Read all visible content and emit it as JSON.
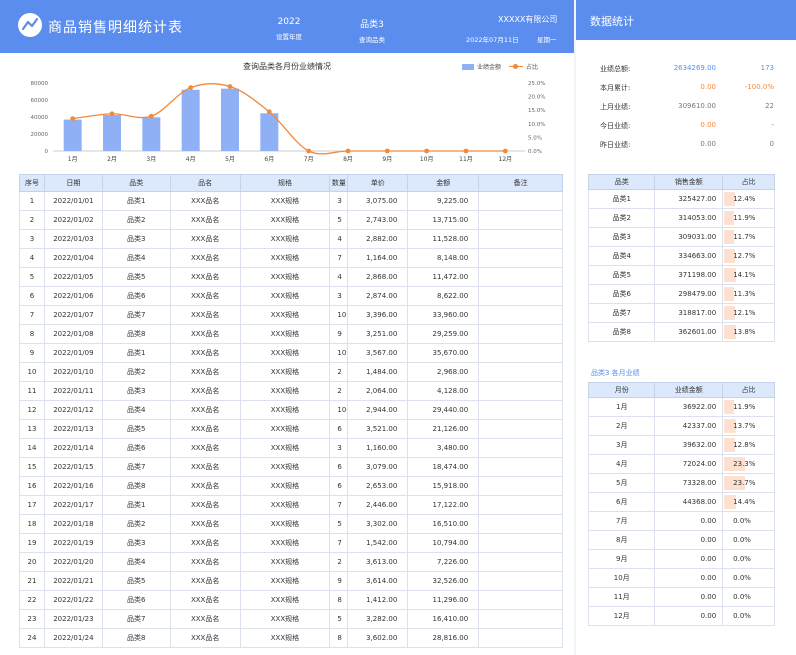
{
  "header": {
    "title": "商品销售明细统计表",
    "year_value": "2022",
    "year_label": "设置年度",
    "category_value": "品类3",
    "category_label": "查询品类",
    "company": "XXXXX有限公司",
    "date": "2022年07月11日",
    "weekday": "星期一",
    "accent_color": "#5b8def"
  },
  "right_header": {
    "title": "数据统计"
  },
  "chart_data": {
    "type": "bar",
    "title": "查询品类各月份业绩情况",
    "categories": [
      "1月",
      "2月",
      "3月",
      "4月",
      "5月",
      "6月",
      "7月",
      "8月",
      "9月",
      "10月",
      "11月",
      "12月"
    ],
    "series": [
      {
        "name": "业绩金额",
        "type": "bar",
        "axis": "left",
        "color": "#8fb0f4",
        "values": [
          36922,
          42337,
          39632,
          72024,
          73328,
          44368,
          0,
          0,
          0,
          0,
          0,
          0
        ]
      },
      {
        "name": "占比",
        "type": "line",
        "axis": "right",
        "color": "#f08a3c",
        "values": [
          11.9,
          13.7,
          12.8,
          23.3,
          23.7,
          14.4,
          0,
          0,
          0,
          0,
          0,
          0
        ]
      }
    ],
    "ylim_left": [
      0,
      80000
    ],
    "yticks_left": [
      "0",
      "20000",
      "40000",
      "60000",
      "80000"
    ],
    "ylim_right": [
      0,
      25
    ],
    "yticks_right": [
      "0.0%",
      "5.0%",
      "10.0%",
      "15.0%",
      "20.0%",
      "25.0%"
    ],
    "legend_position": "top-right",
    "grid": false
  },
  "table": {
    "headers": [
      "序号",
      "日期",
      "品类",
      "品名",
      "规格",
      "数量",
      "单价",
      "金额",
      "备注"
    ],
    "rows": [
      [
        "1",
        "2022/01/01",
        "品类1",
        "XXX品名",
        "XXX规格",
        "3",
        "3,075.00",
        "9,225.00",
        ""
      ],
      [
        "2",
        "2022/01/02",
        "品类2",
        "XXX品名",
        "XXX规格",
        "5",
        "2,743.00",
        "13,715.00",
        ""
      ],
      [
        "3",
        "2022/01/03",
        "品类3",
        "XXX品名",
        "XXX规格",
        "4",
        "2,882.00",
        "11,528.00",
        ""
      ],
      [
        "4",
        "2022/01/04",
        "品类4",
        "XXX品名",
        "XXX规格",
        "7",
        "1,164.00",
        "8,148.00",
        ""
      ],
      [
        "5",
        "2022/01/05",
        "品类5",
        "XXX品名",
        "XXX规格",
        "4",
        "2,868.00",
        "11,472.00",
        ""
      ],
      [
        "6",
        "2022/01/06",
        "品类6",
        "XXX品名",
        "XXX规格",
        "3",
        "2,874.00",
        "8,622.00",
        ""
      ],
      [
        "7",
        "2022/01/07",
        "品类7",
        "XXX品名",
        "XXX规格",
        "10",
        "3,396.00",
        "33,960.00",
        ""
      ],
      [
        "8",
        "2022/01/08",
        "品类8",
        "XXX品名",
        "XXX规格",
        "9",
        "3,251.00",
        "29,259.00",
        ""
      ],
      [
        "9",
        "2022/01/09",
        "品类1",
        "XXX品名",
        "XXX规格",
        "10",
        "3,567.00",
        "35,670.00",
        ""
      ],
      [
        "10",
        "2022/01/10",
        "品类2",
        "XXX品名",
        "XXX规格",
        "2",
        "1,484.00",
        "2,968.00",
        ""
      ],
      [
        "11",
        "2022/01/11",
        "品类3",
        "XXX品名",
        "XXX规格",
        "2",
        "2,064.00",
        "4,128.00",
        ""
      ],
      [
        "12",
        "2022/01/12",
        "品类4",
        "XXX品名",
        "XXX规格",
        "10",
        "2,944.00",
        "29,440.00",
        ""
      ],
      [
        "13",
        "2022/01/13",
        "品类5",
        "XXX品名",
        "XXX规格",
        "6",
        "3,521.00",
        "21,126.00",
        ""
      ],
      [
        "14",
        "2022/01/14",
        "品类6",
        "XXX品名",
        "XXX规格",
        "3",
        "1,160.00",
        "3,480.00",
        ""
      ],
      [
        "15",
        "2022/01/15",
        "品类7",
        "XXX品名",
        "XXX规格",
        "6",
        "3,079.00",
        "18,474.00",
        ""
      ],
      [
        "16",
        "2022/01/16",
        "品类8",
        "XXX品名",
        "XXX规格",
        "6",
        "2,653.00",
        "15,918.00",
        ""
      ],
      [
        "17",
        "2022/01/17",
        "品类1",
        "XXX品名",
        "XXX规格",
        "7",
        "2,446.00",
        "17,122.00",
        ""
      ],
      [
        "18",
        "2022/01/18",
        "品类2",
        "XXX品名",
        "XXX规格",
        "5",
        "3,302.00",
        "16,510.00",
        ""
      ],
      [
        "19",
        "2022/01/19",
        "品类3",
        "XXX品名",
        "XXX规格",
        "7",
        "1,542.00",
        "10,794.00",
        ""
      ],
      [
        "20",
        "2022/01/20",
        "品类4",
        "XXX品名",
        "XXX规格",
        "2",
        "3,613.00",
        "7,226.00",
        ""
      ],
      [
        "21",
        "2022/01/21",
        "品类5",
        "XXX品名",
        "XXX规格",
        "9",
        "3,614.00",
        "32,526.00",
        ""
      ],
      [
        "22",
        "2022/01/22",
        "品类6",
        "XXX品名",
        "XXX规格",
        "8",
        "1,412.00",
        "11,296.00",
        ""
      ],
      [
        "23",
        "2022/01/23",
        "品类7",
        "XXX品名",
        "XXX规格",
        "5",
        "3,282.00",
        "16,410.00",
        ""
      ],
      [
        "24",
        "2022/01/24",
        "品类8",
        "XXX品名",
        "XXX规格",
        "8",
        "3,602.00",
        "28,816.00",
        ""
      ]
    ]
  },
  "stats": [
    {
      "label": "业绩总额:",
      "value": "2634269.00",
      "extra": "173",
      "value_color": "blue",
      "extra_color": "blue"
    },
    {
      "label": "本月累计:",
      "value": "0.00",
      "extra": "-100.0%",
      "value_color": "orange",
      "extra_color": "orange"
    },
    {
      "label": "上月业绩:",
      "value": "309610.00",
      "extra": "22",
      "value_color": "",
      "extra_color": ""
    },
    {
      "label": "今日业绩:",
      "value": "0.00",
      "extra": "-",
      "value_color": "orange",
      "extra_color": ""
    },
    {
      "label": "昨日业绩:",
      "value": "0.00",
      "extra": "0",
      "value_color": "",
      "extra_color": ""
    }
  ],
  "category_table": {
    "headers": [
      "品类",
      "销售金额",
      "占比"
    ],
    "rows": [
      {
        "name": "品类1",
        "amount": "325427.00",
        "pct": "12.4%",
        "share": 0.124
      },
      {
        "name": "品类2",
        "amount": "314053.00",
        "pct": "11.9%",
        "share": 0.119
      },
      {
        "name": "品类3",
        "amount": "309031.00",
        "pct": "11.7%",
        "share": 0.117
      },
      {
        "name": "品类4",
        "amount": "334663.00",
        "pct": "12.7%",
        "share": 0.127
      },
      {
        "name": "品类5",
        "amount": "371198.00",
        "pct": "14.1%",
        "share": 0.141
      },
      {
        "name": "品类6",
        "amount": "298479.00",
        "pct": "11.3%",
        "share": 0.113
      },
      {
        "name": "品类7",
        "amount": "318817.00",
        "pct": "12.1%",
        "share": 0.121
      },
      {
        "name": "品类8",
        "amount": "362601.00",
        "pct": "13.8%",
        "share": 0.138
      }
    ]
  },
  "month_caption": "品类3  各月业绩",
  "month_table": {
    "headers": [
      "月份",
      "业绩金额",
      "占比"
    ],
    "rows": [
      {
        "name": "1月",
        "amount": "36922.00",
        "pct": "11.9%",
        "share": 0.119
      },
      {
        "name": "2月",
        "amount": "42337.00",
        "pct": "13.7%",
        "share": 0.137
      },
      {
        "name": "3月",
        "amount": "39632.00",
        "pct": "12.8%",
        "share": 0.128
      },
      {
        "name": "4月",
        "amount": "72024.00",
        "pct": "23.3%",
        "share": 0.233
      },
      {
        "name": "5月",
        "amount": "73328.00",
        "pct": "23.7%",
        "share": 0.237
      },
      {
        "name": "6月",
        "amount": "44368.00",
        "pct": "14.4%",
        "share": 0.144
      },
      {
        "name": "7月",
        "amount": "0.00",
        "pct": "0.0%",
        "share": 0
      },
      {
        "name": "8月",
        "amount": "0.00",
        "pct": "0.0%",
        "share": 0
      },
      {
        "name": "9月",
        "amount": "0.00",
        "pct": "0.0%",
        "share": 0
      },
      {
        "name": "10月",
        "amount": "0.00",
        "pct": "0.0%",
        "share": 0
      },
      {
        "name": "11月",
        "amount": "0.00",
        "pct": "0.0%",
        "share": 0
      },
      {
        "name": "12月",
        "amount": "0.00",
        "pct": "0.0%",
        "share": 0
      }
    ]
  }
}
